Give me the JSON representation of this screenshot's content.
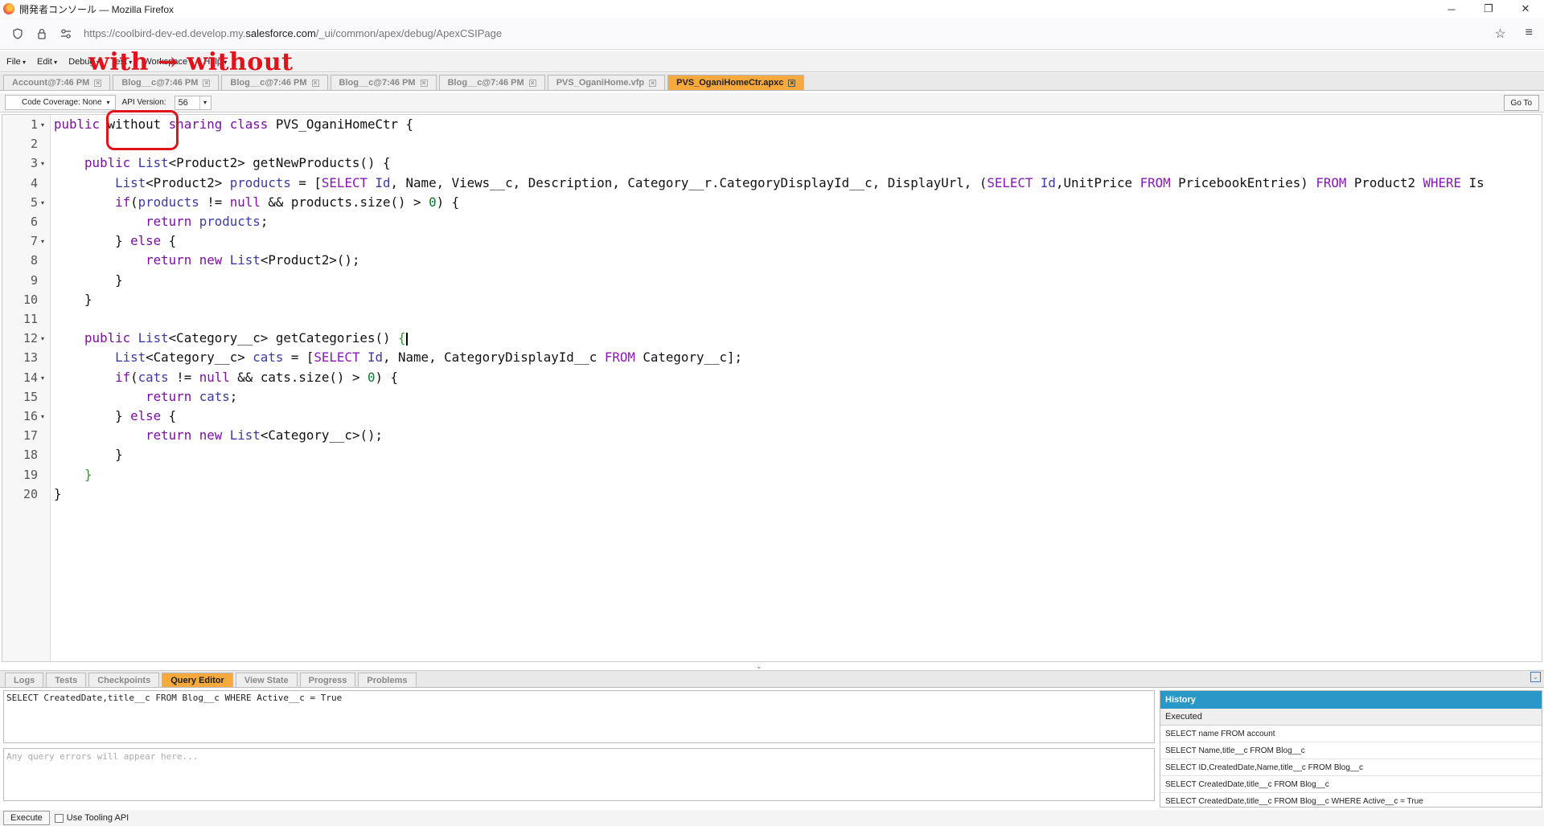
{
  "window": {
    "title": "開発者コンソール — Mozilla Firefox",
    "buttons": [
      "─",
      "❐",
      "✕"
    ]
  },
  "urlbar": {
    "url_prefix": "https://coolbird-dev-ed.develop.my.",
    "url_domain": "salesforce.com",
    "url_suffix": "/_ui/common/apex/debug/ApexCSIPage"
  },
  "menu": {
    "items": [
      "File",
      "Edit",
      "Debug",
      "Test",
      "Workspace",
      "Help"
    ]
  },
  "annotation": {
    "text": "with → without"
  },
  "file_tabs": [
    {
      "label": "Account@7:46 PM",
      "active": false
    },
    {
      "label": "Blog__c@7:46 PM",
      "active": false
    },
    {
      "label": "Blog__c@7:46 PM",
      "active": false
    },
    {
      "label": "Blog__c@7:46 PM",
      "active": false
    },
    {
      "label": "Blog__c@7:46 PM",
      "active": false
    },
    {
      "label": "PVS_OganiHome.vfp",
      "active": false
    },
    {
      "label": "PVS_OganiHomeCtr.apxc",
      "active": true
    }
  ],
  "editor_toolbar": {
    "code_coverage": "Code Coverage: None",
    "api_version_label": "API Version:",
    "api_version": "56",
    "goto_label": "Go To"
  },
  "code_lines": [
    {
      "n": "1",
      "fold": true
    },
    {
      "n": "2",
      "fold": false
    },
    {
      "n": "3",
      "fold": true
    },
    {
      "n": "4",
      "fold": false
    },
    {
      "n": "5",
      "fold": true
    },
    {
      "n": "6",
      "fold": false
    },
    {
      "n": "7",
      "fold": true
    },
    {
      "n": "8",
      "fold": false
    },
    {
      "n": "9",
      "fold": false
    },
    {
      "n": "10",
      "fold": false
    },
    {
      "n": "11",
      "fold": false
    },
    {
      "n": "12",
      "fold": true
    },
    {
      "n": "13",
      "fold": false
    },
    {
      "n": "14",
      "fold": true
    },
    {
      "n": "15",
      "fold": false
    },
    {
      "n": "16",
      "fold": true
    },
    {
      "n": "17",
      "fold": false
    },
    {
      "n": "18",
      "fold": false
    },
    {
      "n": "19",
      "fold": false
    },
    {
      "n": "20",
      "fold": false
    }
  ],
  "code": [
    [
      [
        "kw",
        "public "
      ],
      [
        "plain",
        "without "
      ],
      [
        "kw",
        "sharing "
      ],
      [
        "kw",
        "class "
      ],
      [
        "plain",
        "PVS_OganiHomeCtr {"
      ]
    ],
    [],
    [
      [
        "plain",
        "    "
      ],
      [
        "kw",
        "public "
      ],
      [
        "ty",
        "List"
      ],
      [
        "plain",
        "<Product2> getNewProducts() {"
      ]
    ],
    [
      [
        "plain",
        "        "
      ],
      [
        "ty",
        "List"
      ],
      [
        "plain",
        "<Product2> "
      ],
      [
        "ty",
        "products"
      ],
      [
        "plain",
        " = ["
      ],
      [
        "sq",
        "SELECT "
      ],
      [
        "ty",
        "Id"
      ],
      [
        "plain",
        ", Name, Views__c, Description, Category__r.CategoryDisplayId__c, DisplayUrl, ("
      ],
      [
        "sq",
        "SELECT "
      ],
      [
        "ty",
        "Id"
      ],
      [
        "plain",
        ",UnitPrice "
      ],
      [
        "sq",
        "FROM "
      ],
      [
        "plain",
        "PricebookEntries) "
      ],
      [
        "sq",
        "FROM "
      ],
      [
        "plain",
        "Product2 "
      ],
      [
        "sq",
        "WHERE "
      ],
      [
        "plain",
        "Is"
      ]
    ],
    [
      [
        "plain",
        "        "
      ],
      [
        "kw",
        "if"
      ],
      [
        "plain",
        "("
      ],
      [
        "ty",
        "products"
      ],
      [
        "plain",
        " != "
      ],
      [
        "kw",
        "null"
      ],
      [
        "plain",
        " && products.size() > "
      ],
      [
        "num",
        "0"
      ],
      [
        "plain",
        ") {"
      ]
    ],
    [
      [
        "plain",
        "            "
      ],
      [
        "kw",
        "return "
      ],
      [
        "ty",
        "products"
      ],
      [
        "plain",
        ";"
      ]
    ],
    [
      [
        "plain",
        "        } "
      ],
      [
        "kw",
        "else"
      ],
      [
        "plain",
        " {"
      ]
    ],
    [
      [
        "plain",
        "            "
      ],
      [
        "kw",
        "return "
      ],
      [
        "kw",
        "new "
      ],
      [
        "ty",
        "List"
      ],
      [
        "plain",
        "<Product2>();"
      ]
    ],
    [
      [
        "plain",
        "        }"
      ]
    ],
    [
      [
        "plain",
        "    }"
      ]
    ],
    [],
    [
      [
        "plain",
        "    "
      ],
      [
        "kw",
        "public "
      ],
      [
        "ty",
        "List"
      ],
      [
        "plain",
        "<Category__c> getCategories() "
      ],
      [
        "brk-g",
        "{"
      ],
      [
        "cursor",
        ""
      ]
    ],
    [
      [
        "plain",
        "        "
      ],
      [
        "ty",
        "List"
      ],
      [
        "plain",
        "<Category__c> "
      ],
      [
        "ty",
        "cats"
      ],
      [
        "plain",
        " = ["
      ],
      [
        "sq",
        "SELECT "
      ],
      [
        "ty",
        "Id"
      ],
      [
        "plain",
        ", Name, CategoryDisplayId__c "
      ],
      [
        "sq",
        "FROM "
      ],
      [
        "plain",
        "Category__c];"
      ]
    ],
    [
      [
        "plain",
        "        "
      ],
      [
        "kw",
        "if"
      ],
      [
        "plain",
        "("
      ],
      [
        "ty",
        "cats"
      ],
      [
        "plain",
        " != "
      ],
      [
        "kw",
        "null"
      ],
      [
        "plain",
        " && cats.size() > "
      ],
      [
        "num",
        "0"
      ],
      [
        "plain",
        ") {"
      ]
    ],
    [
      [
        "plain",
        "            "
      ],
      [
        "kw",
        "return "
      ],
      [
        "ty",
        "cats"
      ],
      [
        "plain",
        ";"
      ]
    ],
    [
      [
        "plain",
        "        } "
      ],
      [
        "kw",
        "else"
      ],
      [
        "plain",
        " {"
      ]
    ],
    [
      [
        "plain",
        "            "
      ],
      [
        "kw",
        "return "
      ],
      [
        "kw",
        "new "
      ],
      [
        "ty",
        "List"
      ],
      [
        "plain",
        "<Category__c>();"
      ]
    ],
    [
      [
        "plain",
        "        }"
      ]
    ],
    [
      [
        "plain",
        "    "
      ],
      [
        "brk-g",
        "}"
      ]
    ],
    [
      [
        "plain",
        "}"
      ]
    ]
  ],
  "bottom_tabs": [
    {
      "label": "Logs",
      "active": false
    },
    {
      "label": "Tests",
      "active": false
    },
    {
      "label": "Checkpoints",
      "active": false
    },
    {
      "label": "Query Editor",
      "active": true
    },
    {
      "label": "View State",
      "active": false
    },
    {
      "label": "Progress",
      "active": false
    },
    {
      "label": "Problems",
      "active": false
    }
  ],
  "query": {
    "text": "SELECT CreatedDate,title__c FROM Blog__c WHERE Active__c = True",
    "errors_placeholder": "Any query errors will appear here..."
  },
  "history": {
    "title": "History",
    "subheader": "Executed",
    "rows": [
      "SELECT name FROM account",
      "SELECT Name,title__c FROM Blog__c",
      "SELECT ID,CreatedDate,Name,title__c FROM Blog__c",
      "SELECT CreatedDate,title__c FROM Blog__c",
      "SELECT CreatedDate,title__c FROM Blog__c WHERE Active__c = True"
    ]
  },
  "bottom_bar": {
    "execute_label": "Execute",
    "tooling_label": "Use Tooling API"
  }
}
